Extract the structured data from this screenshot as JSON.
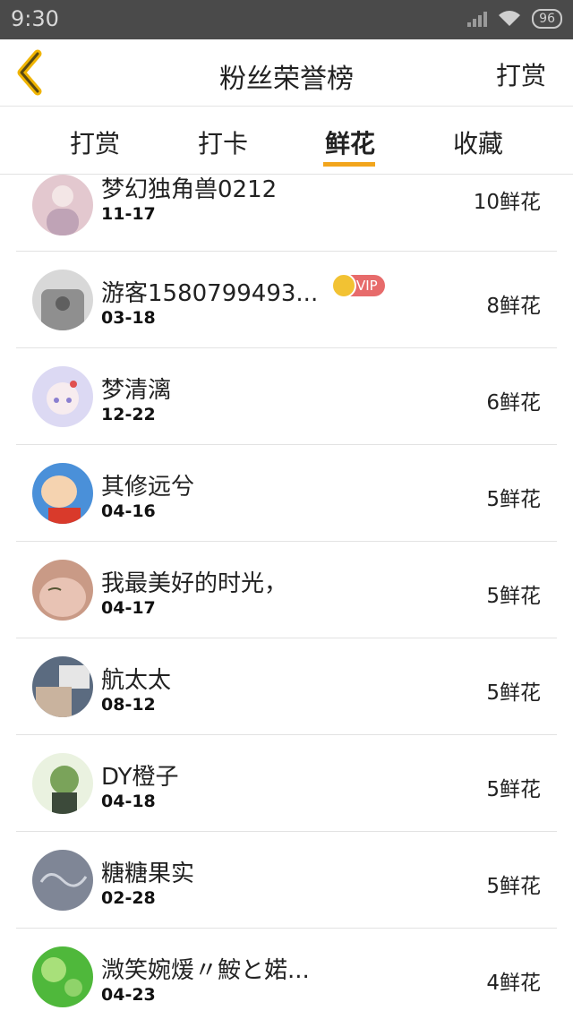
{
  "status_bar": {
    "time": "9:30",
    "battery": "96"
  },
  "header": {
    "title": "粉丝荣誉榜",
    "action_label": "打赏"
  },
  "tabs": [
    {
      "label": "打赏",
      "active": false
    },
    {
      "label": "打卡",
      "active": false
    },
    {
      "label": "鲜花",
      "active": true
    },
    {
      "label": "收藏",
      "active": false
    }
  ],
  "vip_label": "VIP",
  "fans": [
    {
      "name": "梦幻独角兽0212",
      "date": "11-17",
      "count": "10鲜花",
      "avatar_color": "#e3c8cf"
    },
    {
      "name": "游客1580799493...",
      "date": "03-18",
      "count": "8鲜花",
      "avatar_color": "#8f8f8f",
      "vip": true
    },
    {
      "name": "梦清漓",
      "date": "12-22",
      "count": "6鲜花",
      "avatar_color": "#dcd9f3"
    },
    {
      "name": "其修远兮",
      "date": "04-16",
      "count": "5鲜花",
      "avatar_color": "#4a90d9"
    },
    {
      "name": "我最美好的时光，",
      "date": "04-17",
      "count": "5鲜花",
      "avatar_color": "#c99a86"
    },
    {
      "name": "航太太",
      "date": "08-12",
      "count": "5鲜花",
      "avatar_color": "#5b6b80"
    },
    {
      "name": "DY橙子",
      "date": "04-18",
      "count": "5鲜花",
      "avatar_color": "#7aa35a"
    },
    {
      "name": "糖糖果实",
      "date": "02-28",
      "count": "5鲜花",
      "avatar_color": "#7f8696"
    },
    {
      "name": "溦笑婉煖〃鮟と婼...",
      "date": "04-23",
      "count": "4鲜花",
      "avatar_color": "#4fb83b"
    }
  ]
}
